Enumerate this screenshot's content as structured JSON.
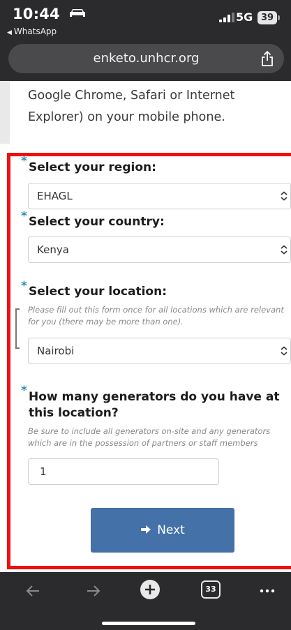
{
  "status_bar": {
    "time": "10:44",
    "back_app": "WhatsApp",
    "network": "5G",
    "battery": "39"
  },
  "browser": {
    "url": "enketo.unhcr.org"
  },
  "page": {
    "intro_text": "Google Chrome, Safari or Internet Explorer) on your mobile phone.",
    "questions": [
      {
        "required_mark": "*",
        "label": "Select your region:",
        "value": "EHAGL"
      },
      {
        "required_mark": "*",
        "label": "Select your country:",
        "value": "Kenya"
      },
      {
        "required_mark": "*",
        "label": "Select your location:",
        "hint": "Please fill out this form once for all locations which are relevant for you (there may be more than one).",
        "value": "Nairobi"
      },
      {
        "required_mark": "*",
        "label": "How many generators do you have at this location?",
        "hint": "Be sure to include all generators on-site and any generators which are in the possession of partners or staff members",
        "value": "1"
      }
    ],
    "next_label": "Next",
    "accent_color": "#4371a8",
    "highlight_color": "#ee0f0f"
  },
  "toolbar": {
    "tab_count": "33"
  }
}
